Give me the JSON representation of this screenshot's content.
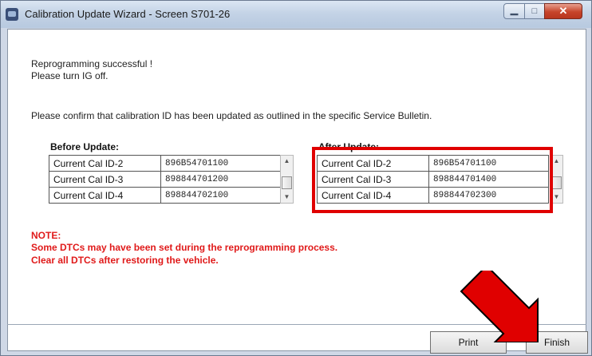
{
  "window": {
    "title": "Calibration Update Wizard - Screen S701-26",
    "controls": [
      "minimize",
      "maximize",
      "close"
    ]
  },
  "messages": {
    "line1": "Reprogramming successful !",
    "line2": "Please turn IG off.",
    "confirm": "Please confirm that calibration ID has been updated as outlined in the specific Service Bulletin."
  },
  "before": {
    "label": "Before Update:",
    "rows": [
      {
        "key": "Current Cal ID-2",
        "value": "896B54701100"
      },
      {
        "key": "Current Cal ID-3",
        "value": "898844701200"
      },
      {
        "key": "Current Cal ID-4",
        "value": "898844702100"
      }
    ]
  },
  "after": {
    "label": "After Update:",
    "rows": [
      {
        "key": "Current Cal ID-2",
        "value": "896B54701100"
      },
      {
        "key": "Current Cal ID-3",
        "value": "898844701400"
      },
      {
        "key": "Current Cal ID-4",
        "value": "898844702300"
      }
    ]
  },
  "note": {
    "title": "NOTE:",
    "line1": "Some DTCs may have been set during the reprogramming process.",
    "line2": "Clear all DTCs after restoring the vehicle."
  },
  "buttons": {
    "print": "Print",
    "finish": "Finish"
  },
  "colors": {
    "highlight": "#e00000",
    "note": "#e01a1a"
  }
}
